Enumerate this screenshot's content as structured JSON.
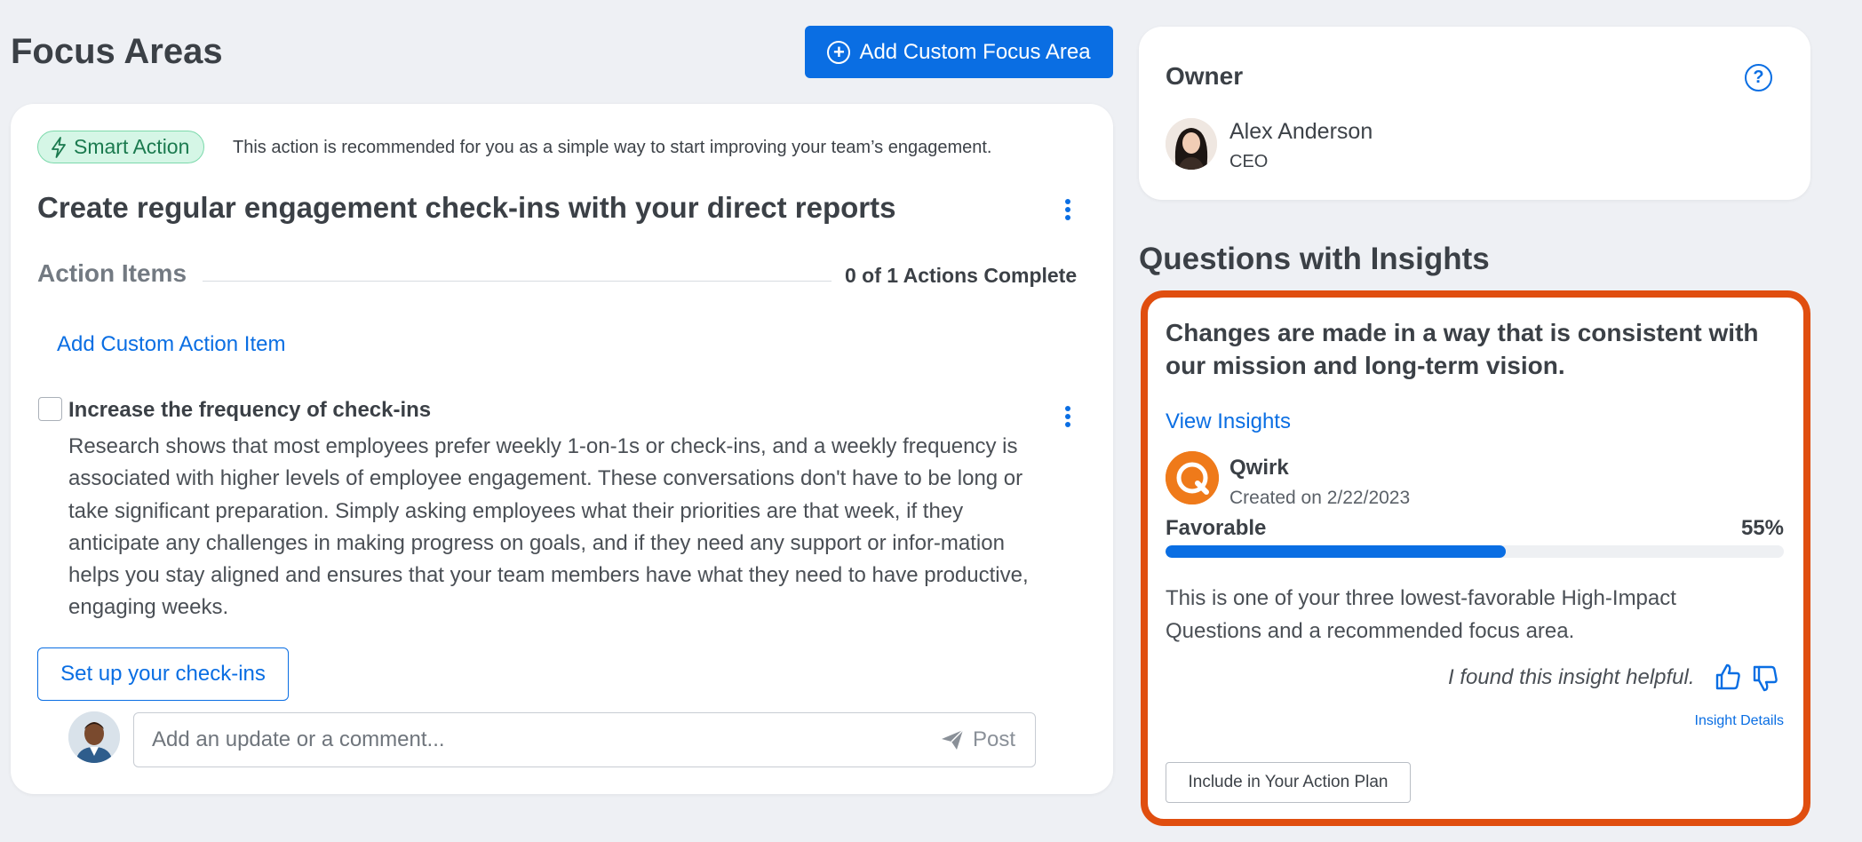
{
  "page": {
    "title": "Focus Areas"
  },
  "header": {
    "add_focus_label": "Add Custom Focus Area"
  },
  "focus_card": {
    "badge_label": "Smart Action",
    "badge_description": "This action is recommended for you as a simple way to start improving your team’s engagement.",
    "title": "Create regular engagement check-ins with your direct reports",
    "action_items_label": "Action Items",
    "action_items_count": "0 of 1 Actions Complete",
    "add_action_label": "Add Custom Action Item",
    "item": {
      "title": "Increase the frequency of check-ins",
      "body": "Research shows that most employees prefer weekly 1-on-1s or check-ins, and a weekly frequency is associated with higher levels of employee engagement. These conversations don't have to be long or take significant preparation. Simply asking employees what their priorities are that week, if they anticipate any challenges in making progress on goals, and if they need any support or infor-mation helps you stay aligned and ensures that your team members have what they need to have productive, engaging weeks."
    },
    "setup_label": "Set up your check-ins",
    "comment_placeholder": "Add an update or a comment...",
    "post_label": "Post"
  },
  "owner": {
    "label": "Owner",
    "name": "Alex Anderson",
    "role": "CEO"
  },
  "insights": {
    "section_title": "Questions with Insights",
    "question": "Changes are made in a way that is consistent with our mission and long-term vision.",
    "view_label": "View Insights",
    "source_name": "Qwirk",
    "created": "Created on 2/22/2023",
    "favorable_label": "Favorable",
    "favorable_pct": "55%",
    "favorable_value": 55,
    "description": "This is one of your three lowest-favorable High-Impact Questions and a recommended focus area.",
    "helpful_prompt": "I found this insight helpful.",
    "details_label": "Insight Details",
    "include_label": "Include in Your Action Plan"
  },
  "colors": {
    "accent": "#0a6ee3",
    "highlight_border": "#e04e0f",
    "smart_badge_bg": "#d5f6e6",
    "qwirk_brand": "#ef7a1a"
  },
  "icons": {
    "add": "plus-circle-icon",
    "smart": "lightning-icon",
    "more": "kebab-icon",
    "post": "send-icon",
    "help": "question-circle-icon",
    "like": "thumbs-up-icon",
    "dislike": "thumbs-down-icon"
  }
}
